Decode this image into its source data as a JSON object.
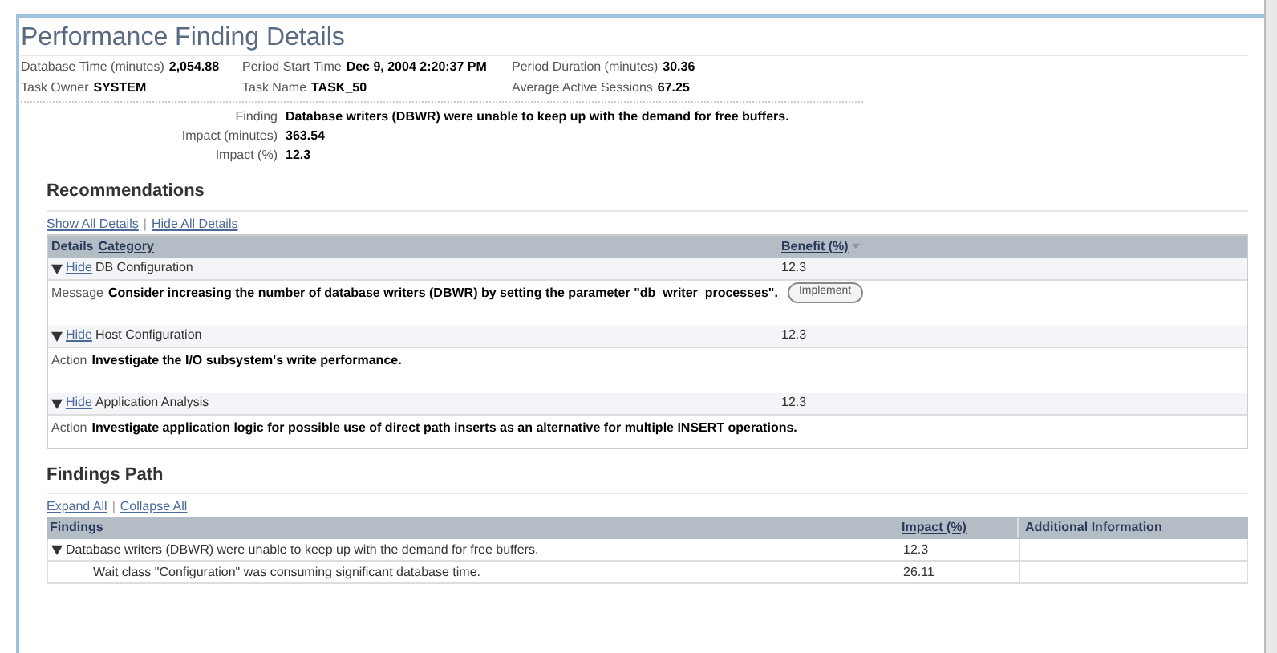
{
  "title": "Performance Finding Details",
  "summary": [
    {
      "label": "Database Time (minutes)",
      "value": "2,054.88"
    },
    {
      "label": "Period Start Time",
      "value": "Dec 9, 2004 2:20:37 PM"
    },
    {
      "label": "Period Duration (minutes)",
      "value": "30.36"
    },
    {
      "label": "Task Owner",
      "value": "SYSTEM"
    },
    {
      "label": "Task Name",
      "value": "TASK_50"
    },
    {
      "label": "Average Active Sessions",
      "value": "67.25"
    }
  ],
  "finding": [
    {
      "label": "Finding",
      "value": "Database writers (DBWR) were unable to keep up with the demand for free buffers."
    },
    {
      "label": "Impact (minutes)",
      "value": "363.54"
    },
    {
      "label": "Impact (%)",
      "value": "12.3"
    }
  ],
  "recommendations": {
    "heading": "Recommendations",
    "links": [
      "Show All Details",
      "Hide All Details"
    ],
    "link_separator": "|",
    "columns": [
      "Details",
      "Category",
      "Benefit (%)"
    ],
    "rows": [
      {
        "toggle": "Hide",
        "expanded": true,
        "category": "DB Configuration",
        "benefit": "12.3",
        "detail_label": "Message",
        "detail": "Consider increasing the number of database writers (DBWR) by setting the parameter \"db_writer_processes\".",
        "button": "Implement"
      },
      {
        "toggle": "Hide",
        "expanded": true,
        "category": "Host Configuration",
        "benefit": "12.3",
        "detail_label": "Action",
        "detail": "Investigate the I/O subsystem's write performance."
      },
      {
        "toggle": "Hide",
        "expanded": true,
        "category": "Application Analysis",
        "benefit": "12.3",
        "detail_label": "Action",
        "detail": "Investigate application logic for possible use of direct path inserts as an alternative for multiple INSERT operations."
      }
    ]
  },
  "findings_path": {
    "heading": "Findings Path",
    "links": [
      "Expand All",
      "Collapse All"
    ],
    "link_separator": "|",
    "columns": [
      "Findings",
      "Impact (%)",
      "Additional Information"
    ],
    "rows": [
      {
        "text": "Database writers (DBWR) were unable to keep up with the demand for free buffers.",
        "impact": "12.3",
        "expanded": true,
        "children": [
          {
            "text": "Wait class \"Configuration\" was consuming significant database time.",
            "impact": "26.11"
          }
        ]
      }
    ]
  }
}
